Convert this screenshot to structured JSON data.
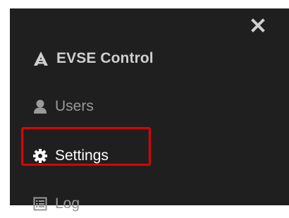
{
  "brand": {
    "label": "EVSE Control",
    "icon": "tower-icon"
  },
  "close_icon": "close-icon",
  "nav": {
    "items": [
      {
        "label": "Users",
        "icon": "user-icon"
      },
      {
        "label": "Settings",
        "icon": "gear-icon"
      },
      {
        "label": "Log",
        "icon": "log-icon"
      }
    ]
  },
  "colors": {
    "panel_bg": "#1f1f1f",
    "text_muted": "#9a9a9a",
    "text_active": "#ffffff",
    "highlight_border": "#e00000"
  }
}
